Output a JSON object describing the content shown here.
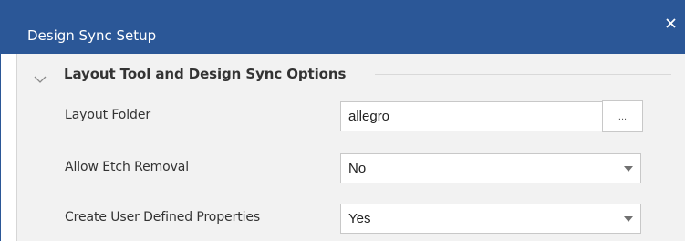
{
  "window": {
    "title": "Design Sync Setup",
    "close_glyph": "×"
  },
  "section": {
    "title": "Layout Tool and Design Sync Options",
    "expanded": true
  },
  "rows": {
    "layout_folder": {
      "label": "Layout Folder",
      "value": "allegro",
      "browse_label": "..."
    },
    "allow_etch_removal": {
      "label": "Allow Etch Removal",
      "value": "No"
    },
    "create_user_defined_properties": {
      "label": "Create User Defined Properties",
      "value": "Yes"
    }
  },
  "colors": {
    "titlebar": "#2b5797",
    "panel": "#f2f2f2",
    "text": "#333333"
  },
  "icons": {
    "close": "close-icon",
    "collapse": "chevron-down-icon",
    "dropdown": "dropdown-caret-icon"
  }
}
